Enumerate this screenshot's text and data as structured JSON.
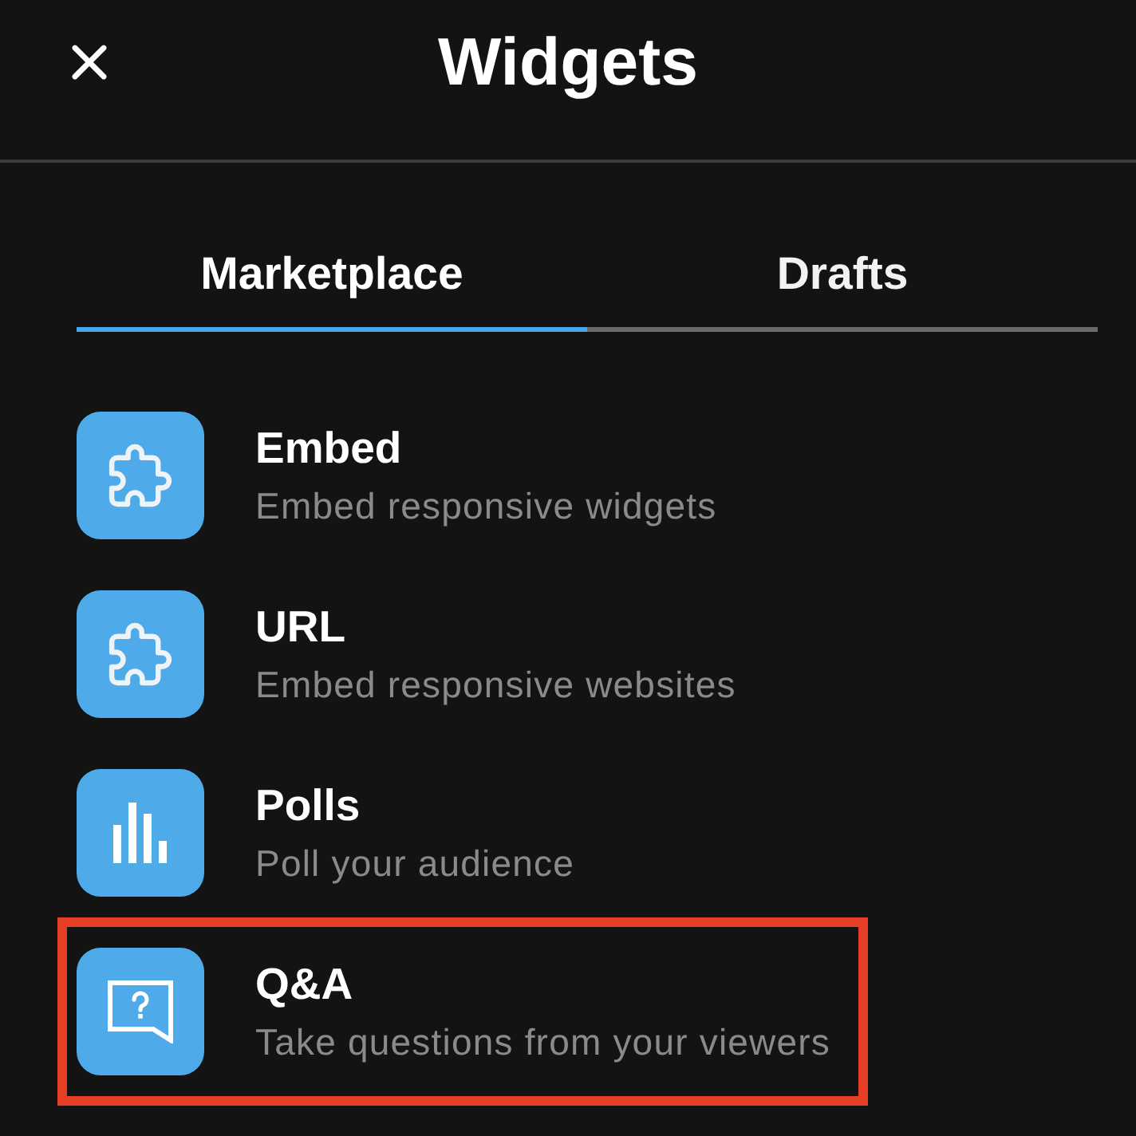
{
  "header": {
    "title": "Widgets"
  },
  "tabs": [
    {
      "label": "Marketplace",
      "selected": true
    },
    {
      "label": "Drafts",
      "selected": false
    }
  ],
  "widgets": [
    {
      "kind": "puzzle",
      "title": "Embed",
      "description": "Embed responsive widgets",
      "highlighted": false
    },
    {
      "kind": "puzzle",
      "title": "URL",
      "description": "Embed responsive websites",
      "highlighted": false
    },
    {
      "kind": "chart",
      "title": "Polls",
      "description": "Poll your audience",
      "highlighted": false
    },
    {
      "kind": "question",
      "title": "Q&A",
      "description": "Take questions from your viewers",
      "highlighted": true
    }
  ]
}
